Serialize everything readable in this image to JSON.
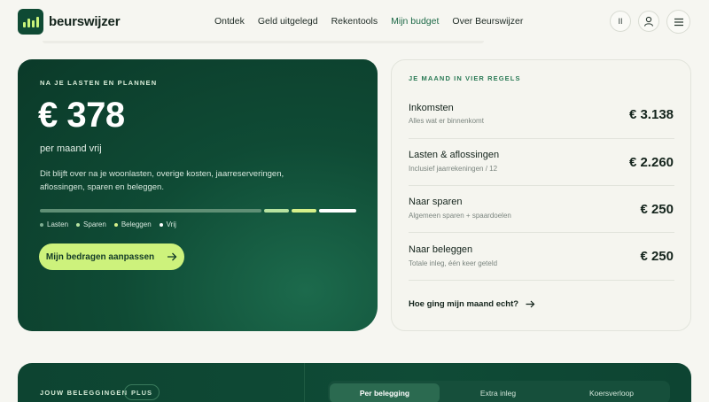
{
  "header": {
    "brand": "beurswijzer",
    "nav": [
      "Ontdek",
      "Geld uitgelegd",
      "Rekentools",
      "Mijn budget",
      "Over Beurswijzer"
    ],
    "active_nav": "Mijn budget",
    "pause_label": "II"
  },
  "hero": {
    "eyebrow": "NA JE LASTEN EN PLANNEN",
    "amount": "€ 378",
    "subtitle": "per maand vrij",
    "description": "Dit blijft over na je woonlasten, overige kosten, jaarreserveringen, aflossingen, sparen en beleggen.",
    "legend": [
      {
        "label": "Lasten",
        "color": "#7fae92"
      },
      {
        "label": "Sparen",
        "color": "#b6e2a0"
      },
      {
        "label": "Beleggen",
        "color": "#d6f08a"
      },
      {
        "label": "Vrij",
        "color": "#ffffff"
      }
    ],
    "breakdown": [
      {
        "label": "Lasten",
        "share": 0.71,
        "color": "#5f8f75"
      },
      {
        "label": "Sparen",
        "share": 0.08,
        "color": "#b6e2a0"
      },
      {
        "label": "Beleggen",
        "share": 0.08,
        "color": "#d6f08a"
      },
      {
        "label": "Vrij",
        "share": 0.12,
        "color": "#ffffff"
      }
    ],
    "cta_label": "Mijn bedragen aanpassen"
  },
  "month": {
    "eyebrow": "JE MAAND IN VIER REGELS",
    "rows": [
      {
        "title": "Inkomsten",
        "sub": "Alles wat er binnenkomt",
        "amount": "€ 3.138"
      },
      {
        "title": "Lasten & aflossingen",
        "sub": "Inclusief jaarrekeningen / 12",
        "amount": "€ 2.260"
      },
      {
        "title": "Naar sparen",
        "sub": "Algemeen sparen + spaardoelen",
        "amount": "€ 250"
      },
      {
        "title": "Naar beleggen",
        "sub": "Totale inleg, één keer geteld",
        "amount": "€ 250"
      }
    ],
    "link_label": "Hoe ging mijn maand echt?"
  },
  "investments": {
    "eyebrow": "JOUW BELEGGINGEN",
    "badge": "PLUS",
    "tabs": [
      "Per belegging",
      "Extra inleg",
      "Koersverloop"
    ],
    "active_tab": "Per belegging"
  },
  "colors": {
    "accent": "#cdf27c",
    "hero_bg": "#0f4b35",
    "eyebrow_green": "#2a7a55",
    "page_bg": "#f6f6f1"
  }
}
